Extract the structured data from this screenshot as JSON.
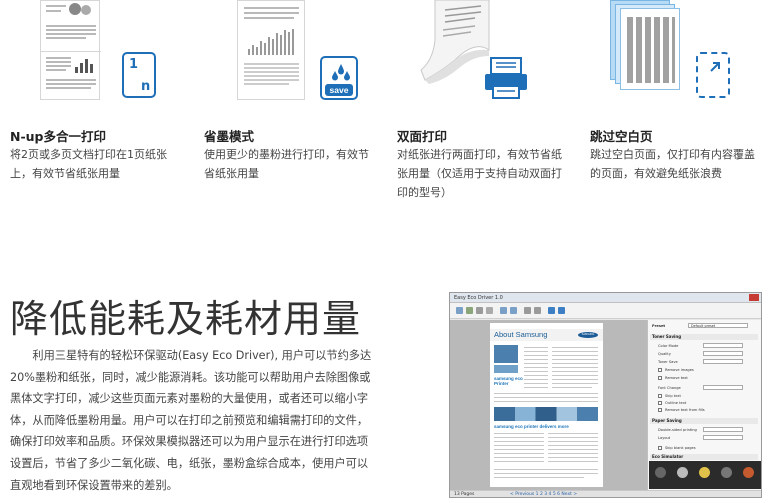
{
  "features": [
    {
      "title": "N-up多合一打印",
      "desc": [
        "将2页或多页文档打印在1页纸张",
        "上，有效节省纸张用量"
      ],
      "icon": "n-up-icon",
      "icon_text": [
        "1",
        "n"
      ]
    },
    {
      "title": "省墨模式",
      "desc": [
        "使用更少的墨粉进行打印，有效节",
        "省纸张用量"
      ],
      "icon": "toner-save-icon",
      "icon_text": "save"
    },
    {
      "title": "双面打印",
      "desc": [
        "对纸张进行两面打印，有效节省纸",
        "张用量（仅适用于支持自动双面打",
        "印的型号）"
      ],
      "icon": "duplex-printer-icon"
    },
    {
      "title": "跳过空白页",
      "desc": [
        "跳过空白页面，仅打印有内容覆盖",
        "的页面，有效避免纸张浪费"
      ],
      "icon": "skip-blank-page-icon"
    }
  ],
  "section": {
    "title": "降低能耗及耗材用量",
    "body": "利用三星特有的轻松环保驱动(Easy Eco Driver), 用户可以节约多达20%墨粉和纸张，同时，减少能源消耗。该功能可以帮助用户去除图像或黑体文字打印，减少这些页面元素对墨粉的大量使用，或者还可以缩小字体，从而降低墨粉用量。用户可以在打印之前预览和编辑需打印的文件，确保打印效率和品质。环保效果模拟器还可以为用户显示在进行打印选项设置后，节省了多少二氧化碳、电，纸张，墨粉盒综合成本，使用户可以直观地看到环保设置带来的差别。"
  },
  "software": {
    "window_title": "Easy Eco Driver 1.0",
    "page_title": "About Samsung",
    "page_brand": "SAMSUNG",
    "page_heading_1": "samsung eco Printer",
    "page_heading_2": "samsung eco printer delivers more",
    "status_left": "13 Pages",
    "status_nav": "< Previous  1  2  3  4  5  6  Next >",
    "panel": {
      "preset_label": "Preset",
      "preset_value": "Default preset",
      "toner_saving": "Toner Saving",
      "rows": [
        "Color Mode",
        "Quality",
        "Toner Save",
        "Remove images",
        "Remove text",
        "Font Change",
        "Skip text",
        "Outline text",
        "Remove text from fills"
      ],
      "paper_saving": "Paper Saving",
      "paper_rows": [
        "Double-sided printing",
        "Layout",
        "Skip blank pages"
      ],
      "eco_simulator": "Eco Simulator"
    }
  },
  "colors": {
    "accent_blue": "#1e6fb7",
    "title_text": "#222222",
    "body_text": "#444444"
  }
}
